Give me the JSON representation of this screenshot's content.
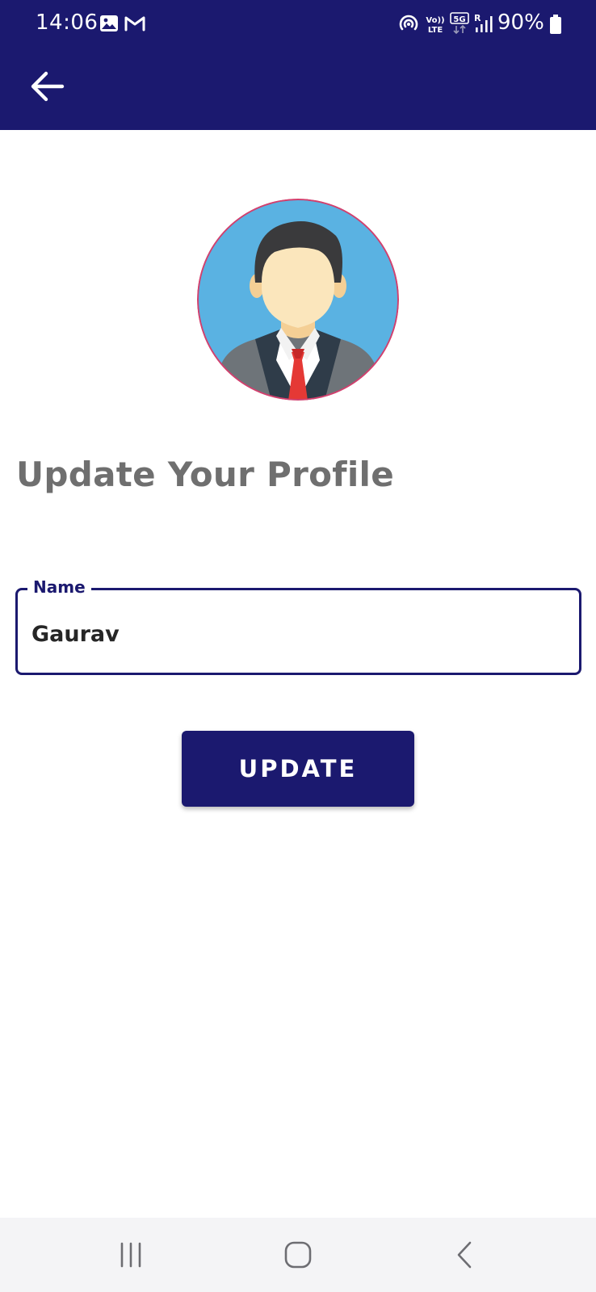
{
  "status_bar": {
    "time": "14:06",
    "battery": "90%",
    "icons": [
      "gallery-icon",
      "gmail-icon",
      "hotspot-icon",
      "volte-icon",
      "5g-icon",
      "signal-icon",
      "battery-icon"
    ]
  },
  "header": {
    "back_icon": "arrow-left-icon",
    "background": "#1b196f"
  },
  "profile": {
    "avatar_icon": "businessman-avatar",
    "title": "Update Your Profile"
  },
  "form": {
    "name_label": "Name",
    "name_value": "Gaurav"
  },
  "update_button": {
    "label": "UPDATE"
  },
  "nav_bar": {
    "items": [
      "recent-apps-icon",
      "home-icon",
      "back-icon"
    ]
  },
  "colors": {
    "primary": "#1b196f",
    "title_gray": "#6f6f6f",
    "avatar_bg": "#5ab2e2",
    "tie_red": "#e53935"
  }
}
